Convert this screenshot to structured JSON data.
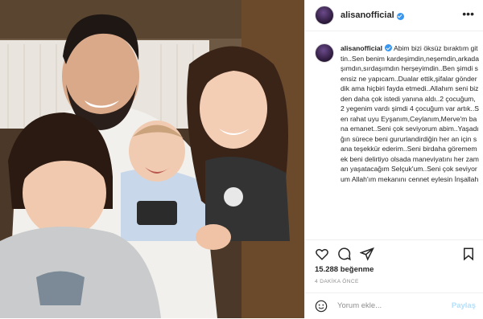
{
  "post": {
    "username": "alisanofficial",
    "caption": {
      "username": "alisanofficial",
      "text": "Abim bizi öksüz bıraktım gittin..Sen benim kardeşimdin,neşemdin,arkadaşımdın,sırdaşımdın herşeyimdin..Ben şimdi sensiz ne yapıcam..Dualar ettik,şifalar gönderdik ama hiçbiri fayda etmedi..Allahım seni bizden daha çok istedi yanına aldı..2 çocuğum,2 yegenim vardı şimdi 4 çocuğum var artık..Sen rahat uyu Eyşanım,Ceylanım,Merve'm bana emanet..Seni çok seviyorum abim..Yaşadığın sürece beni gururlandirdiğin her an için sana teşekkür ederim..Seni birdaha görememek beni delirtiyo olsada maneviyatını her zaman yaşatacağım Selçuk'um..Seni çok seviyorum Allah'ım mekanını cennet eylesin İnşallah"
    },
    "likes": "15.288 beğenme",
    "time_ago": "4 DAKİKA ÖNCE",
    "comment_placeholder": "Yorum ekle...",
    "share_label": "Paylaş",
    "more_label": "•••",
    "icons": {
      "like": "heart-icon",
      "comment": "comment-icon",
      "share": "paper-plane-icon",
      "save": "bookmark-icon",
      "emoji": "smiley-icon",
      "verified": "verified-badge-icon"
    },
    "colors": {
      "verified": "#3897f0",
      "share_disabled": "#b2dffc",
      "muted": "#8e8e8e"
    }
  }
}
